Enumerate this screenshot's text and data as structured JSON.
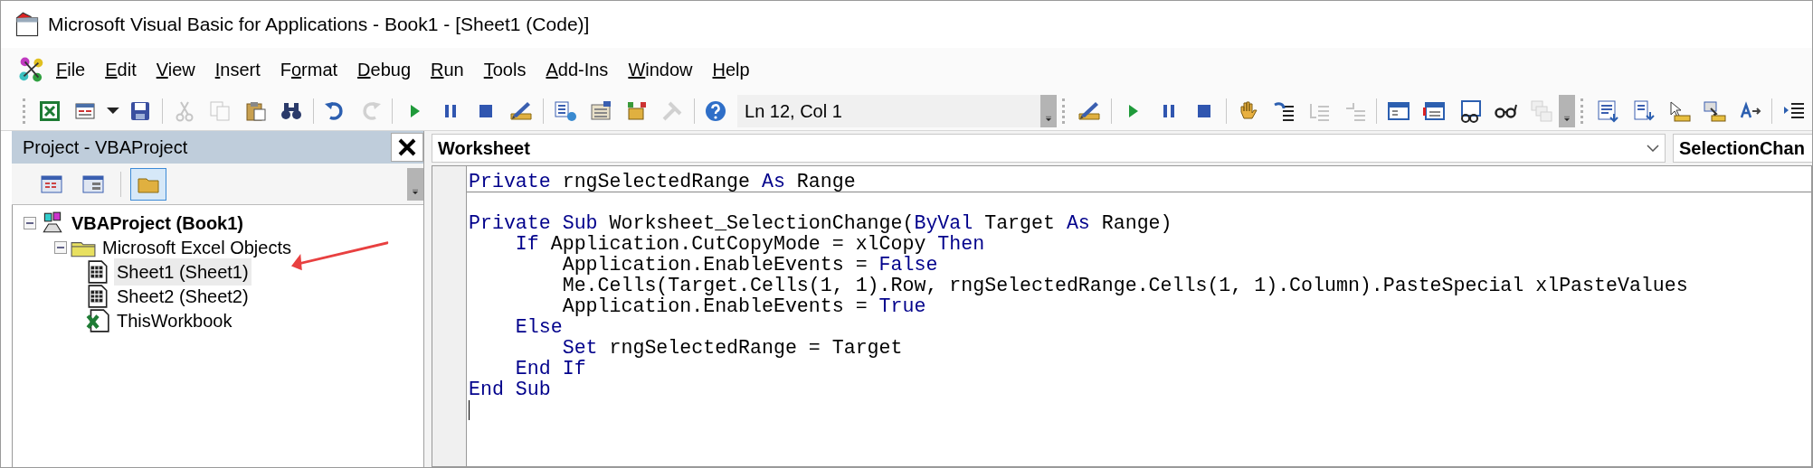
{
  "window": {
    "title": "Microsoft Visual Basic for Applications - Book1 - [Sheet1 (Code)]"
  },
  "menu": [
    {
      "key": "F",
      "post": "ile"
    },
    {
      "key": "E",
      "post": "dit"
    },
    {
      "key": "V",
      "post": "iew"
    },
    {
      "key": "I",
      "post": "nsert"
    },
    {
      "pre": "F",
      "key": "o",
      "post": "rmat"
    },
    {
      "key": "D",
      "post": "ebug"
    },
    {
      "key": "R",
      "post": "un"
    },
    {
      "key": "T",
      "post": "ools"
    },
    {
      "key": "A",
      "post": "dd-Ins"
    },
    {
      "key": "W",
      "post": "indow"
    },
    {
      "key": "H",
      "post": "elp"
    }
  ],
  "toolbar": {
    "buttons": [
      {
        "disabled": false
      },
      {
        "disabled": false
      },
      {
        "disabled": false
      },
      {
        "disabled": true
      },
      {
        "disabled": true
      },
      {
        "disabled": false
      },
      {
        "disabled": false
      },
      {
        "disabled": false
      },
      {
        "disabled": true
      },
      {
        "disabled": false
      },
      {
        "disabled": false
      },
      {
        "disabled": false
      },
      {
        "disabled": false
      },
      {
        "disabled": false
      },
      {
        "disabled": false
      },
      {
        "disabled": false
      },
      {
        "disabled": true
      },
      {
        "disabled": false
      }
    ],
    "position": "Ln 12, Col 1",
    "debug_buttons": [
      {
        "disabled": false
      },
      {
        "disabled": false
      },
      {
        "disabled": false
      },
      {
        "disabled": false
      },
      {
        "disabled": false
      },
      {
        "disabled": false
      },
      {
        "disabled": true
      },
      {
        "disabled": true
      },
      {
        "disabled": false
      },
      {
        "disabled": false
      },
      {
        "disabled": false
      },
      {
        "disabled": false
      },
      {
        "disabled": true
      }
    ],
    "edit_buttons": [
      {
        "disabled": false
      },
      {
        "disabled": false
      },
      {
        "disabled": false
      },
      {
        "disabled": false
      },
      {
        "disabled": false
      },
      {
        "disabled": false
      }
    ]
  },
  "project": {
    "title": "Project - VBAProject",
    "tree": [
      {
        "label": "VBAProject (Book1)",
        "selected": false,
        "expanded": true,
        "children": [
          {
            "label": "Microsoft Excel Objects",
            "selected": false,
            "expanded": true,
            "children": [
              {
                "label": "Sheet1 (Sheet1)",
                "selected": true,
                "kind": "sheet"
              },
              {
                "label": "Sheet2 (Sheet2)",
                "selected": false,
                "kind": "sheet"
              },
              {
                "label": "ThisWorkbook",
                "selected": false,
                "kind": "workbook"
              }
            ]
          }
        ]
      }
    ]
  },
  "code": {
    "object": "Worksheet",
    "procedure": "SelectionChan",
    "lines": [
      {
        "kind": "code",
        "separator_after": true,
        "tokens": [
          {
            "kind": "keyword",
            "text": "Private"
          },
          {
            "kind": "plain",
            "text": " rngSelectedRange "
          },
          {
            "kind": "keyword",
            "text": "As"
          },
          {
            "kind": "plain",
            "text": " Range"
          }
        ]
      },
      {
        "kind": "blank",
        "separator_after": false
      },
      {
        "kind": "code",
        "separator_after": false,
        "tokens": [
          {
            "kind": "keyword",
            "text": "Private Sub"
          },
          {
            "kind": "plain",
            "text": " Worksheet_SelectionChange("
          },
          {
            "kind": "keyword",
            "text": "ByVal"
          },
          {
            "kind": "plain",
            "text": " Target "
          },
          {
            "kind": "keyword",
            "text": "As"
          },
          {
            "kind": "plain",
            "text": " Range)"
          }
        ]
      },
      {
        "kind": "code",
        "separator_after": false,
        "tokens": [
          {
            "kind": "keyword",
            "text": "    If"
          },
          {
            "kind": "plain",
            "text": " Application.CutCopyMode = xlCopy "
          },
          {
            "kind": "keyword",
            "text": "Then"
          }
        ]
      },
      {
        "kind": "code",
        "separator_after": false,
        "tokens": [
          {
            "kind": "plain",
            "text": "        Application.EnableEvents = "
          },
          {
            "kind": "keyword",
            "text": "False"
          }
        ]
      },
      {
        "kind": "code",
        "separator_after": false,
        "tokens": [
          {
            "kind": "plain",
            "text": "        Me.Cells(Target.Cells(1, 1).Row, rngSelectedRange.Cells(1, 1).Column).PasteSpecial xlPasteValues"
          }
        ]
      },
      {
        "kind": "code",
        "separator_after": false,
        "tokens": [
          {
            "kind": "plain",
            "text": "        Application.EnableEvents = "
          },
          {
            "kind": "keyword",
            "text": "True"
          }
        ]
      },
      {
        "kind": "code",
        "separator_after": false,
        "tokens": [
          {
            "kind": "keyword",
            "text": "    Else"
          }
        ]
      },
      {
        "kind": "code",
        "separator_after": false,
        "tokens": [
          {
            "kind": "keyword",
            "text": "        Set"
          },
          {
            "kind": "plain",
            "text": " rngSelectedRange = Target"
          }
        ]
      },
      {
        "kind": "code",
        "separator_after": false,
        "tokens": [
          {
            "kind": "keyword",
            "text": "    End If"
          }
        ]
      },
      {
        "kind": "code",
        "separator_after": false,
        "tokens": [
          {
            "kind": "keyword",
            "text": "End Sub"
          }
        ]
      }
    ]
  }
}
